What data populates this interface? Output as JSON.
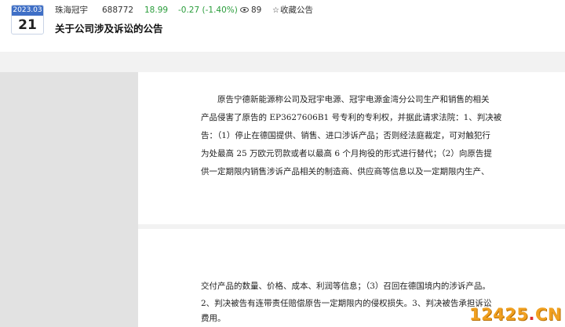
{
  "header": {
    "date_year_month": "2023.03",
    "date_day": "21",
    "stock_name": "珠海冠宇",
    "stock_code": "688772",
    "price": "18.99",
    "change": "-0.27 (-1.40%)",
    "views": "89",
    "favorite_label": "收藏公告",
    "title": "关于公司涉及诉讼的公告"
  },
  "colors": {
    "date_badge_bg": "#3f6fc6",
    "price_color": "#2a9d3b",
    "viewer_bg": "#f2f2f2"
  },
  "icons": {
    "views": "eye-icon",
    "favorite": "star-icon"
  },
  "document": {
    "page1_lines": [
      "原告宁德新能源称公司及冠宇电源、冠宇电源金湾分公司生产和销售的相关",
      "产品侵害了原告的 EP3627606B1 号专利的专利权，并据此请求法院：1、判决被",
      "告：（1）停止在德国提供、销售、进口涉诉产品；否则经法庭裁定，可对触犯行",
      "为处最高 25 万欧元罚款或者以最高 6 个月拘役的形式进行替代；（2）向原告提",
      "供一定期限内销售涉诉产品相关的制造商、供应商等信息以及一定期限内生产、"
    ],
    "page2_lines": [
      "交付产品的数量、价格、成本、利润等信息；（3）召回在德国境内的涉诉产品。",
      "2、判决被告有连带责任赔偿原告一定期限内的侵权损失。3、判决被告承担诉讼",
      "费用。"
    ]
  },
  "watermark": {
    "number": "12425",
    "dot": ".",
    "suffix": "CN"
  }
}
